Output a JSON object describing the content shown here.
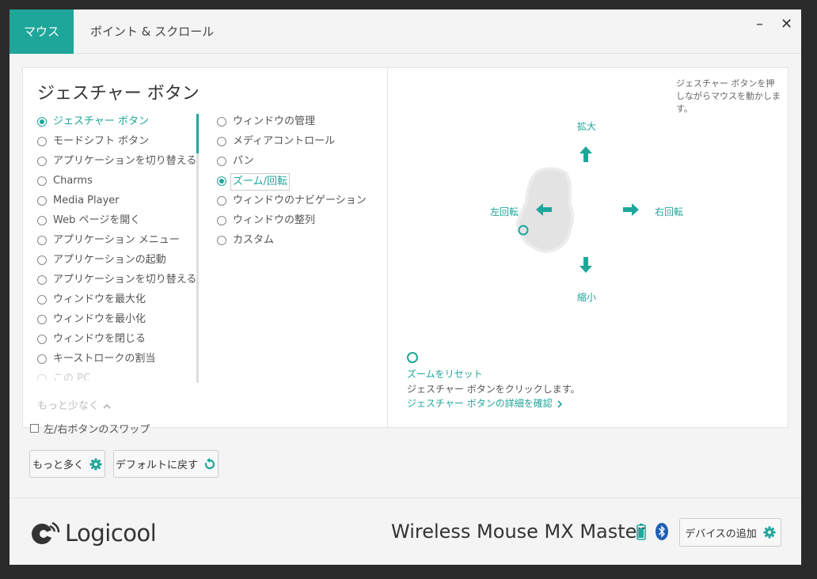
{
  "tabs": [
    {
      "label": "マウス"
    },
    {
      "label": "ポイント & スクロール"
    }
  ],
  "window_controls": {
    "minimize": "–",
    "close": "✕"
  },
  "panel": {
    "title": "ジェスチャー ボタン",
    "list_left": [
      {
        "label": "ジェスチャー ボタン",
        "selected": true
      },
      {
        "label": "モードシフト ボタン"
      },
      {
        "label": "アプリケーションを切り替える"
      },
      {
        "label": "Charms"
      },
      {
        "label": "Media Player"
      },
      {
        "label": "Web ページを開く"
      },
      {
        "label": "アプリケーション メニュー"
      },
      {
        "label": "アプリケーションの起動"
      },
      {
        "label": "アプリケーションを切り替える"
      },
      {
        "label": "ウィンドウを最大化"
      },
      {
        "label": "ウィンドウを最小化"
      },
      {
        "label": "ウィンドウを閉じる"
      },
      {
        "label": "キーストロークの割当"
      },
      {
        "label": "この PC"
      }
    ],
    "list_right": [
      {
        "label": "ウィンドウの管理"
      },
      {
        "label": "メディアコントロール"
      },
      {
        "label": "パン"
      },
      {
        "label": "ズーム/回転",
        "selected": true
      },
      {
        "label": "ウィンドウのナビゲーション"
      },
      {
        "label": "ウィンドウの整列"
      },
      {
        "label": "カスタム"
      }
    ],
    "less_label": "もっと少なく"
  },
  "diagram": {
    "hint": "ジェスチャー ボタンを押しながらマウスを動かします。",
    "up": "拡大",
    "down": "縮小",
    "left": "左回転",
    "right": "右回転",
    "reset_title": "ズームをリセット",
    "reset_desc": "ジェスチャー ボタンをクリックします。",
    "details_link": "ジェスチャー ボタンの詳細を確認"
  },
  "swap_label": "左/右ボタンのスワップ",
  "buttons": {
    "more": "もっと多く",
    "default": "デフォルトに戻す"
  },
  "footer": {
    "brand": "Logicool",
    "device_name": "Wireless Mouse MX Master",
    "add_device": "デバイスの追加"
  },
  "colors": {
    "accent": "#1fa69b",
    "bluetooth": "#1e5fb3"
  }
}
